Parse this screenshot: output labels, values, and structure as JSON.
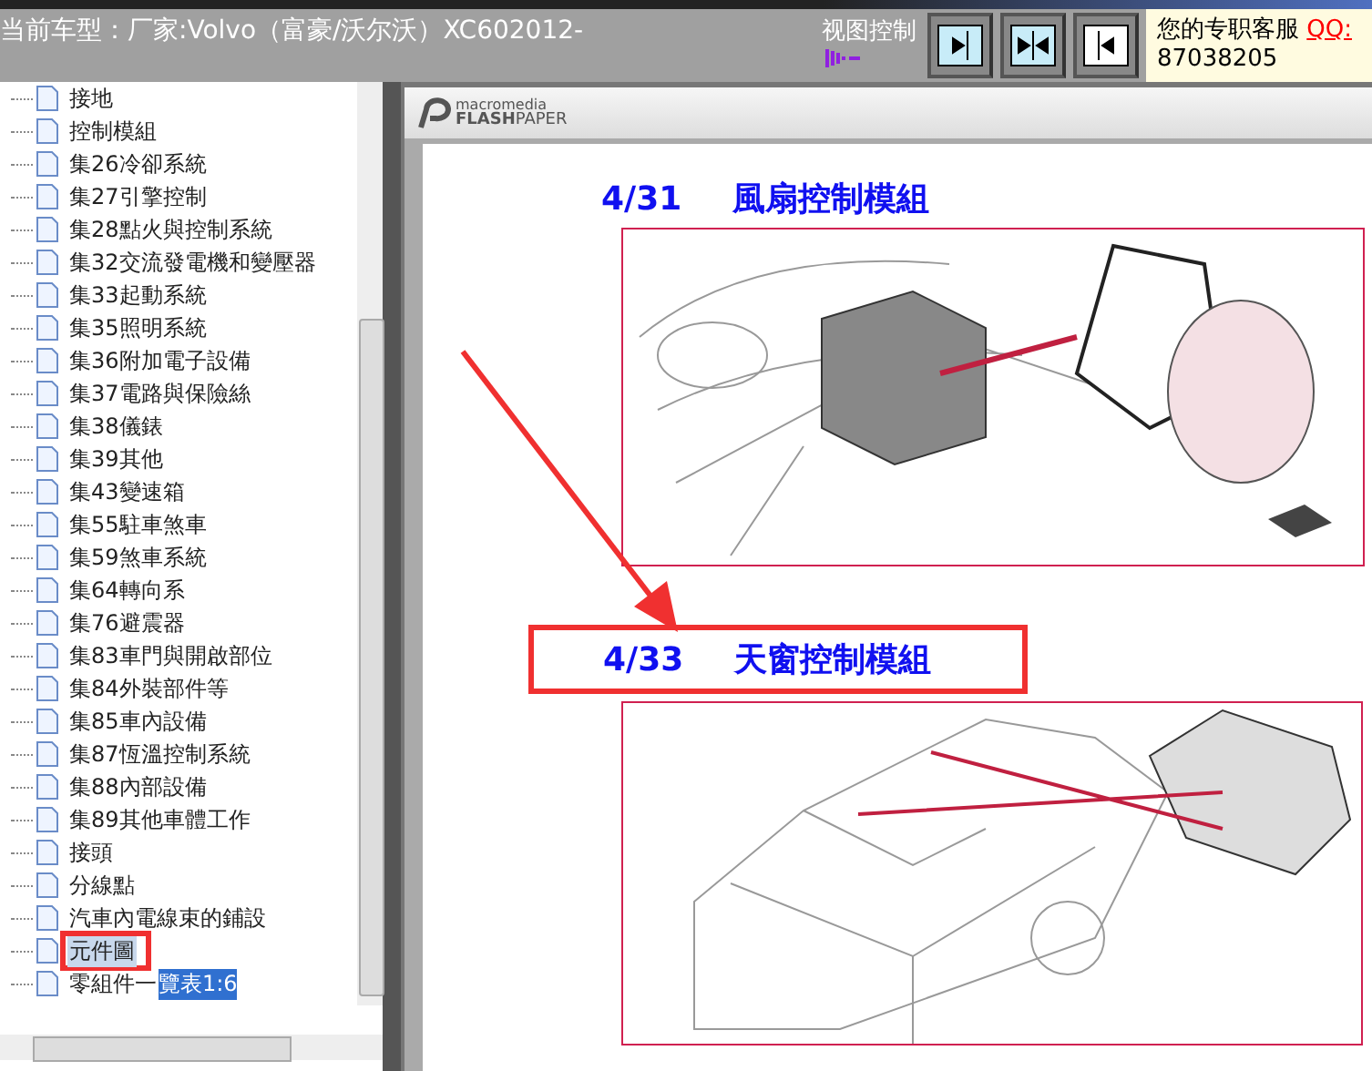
{
  "header": {
    "model": "当前车型：厂家:Volvo（富豪/沃尔沃）XC602012-",
    "view_control": "视图控制",
    "service_label": "您的专职客服",
    "qq_link": "QQ:",
    "qq_number": "87038205"
  },
  "tree": {
    "items": [
      {
        "label": "接地",
        "selected": false
      },
      {
        "label": "控制模組",
        "selected": false
      },
      {
        "label": "集26冷卻系統",
        "selected": false
      },
      {
        "label": "集27引擎控制",
        "selected": false
      },
      {
        "label": "集28點火與控制系統",
        "selected": false
      },
      {
        "label": "集32交流發電機和變壓器",
        "selected": false
      },
      {
        "label": "集33起動系統",
        "selected": false
      },
      {
        "label": "集35照明系統",
        "selected": false
      },
      {
        "label": "集36附加電子設備",
        "selected": false
      },
      {
        "label": "集37電路與保險絲",
        "selected": false
      },
      {
        "label": "集38儀錶",
        "selected": false
      },
      {
        "label": "集39其他",
        "selected": false
      },
      {
        "label": "集43變速箱",
        "selected": false
      },
      {
        "label": "集55駐車煞車",
        "selected": false
      },
      {
        "label": "集59煞車系統",
        "selected": false
      },
      {
        "label": "集64轉向系",
        "selected": false
      },
      {
        "label": "集76避震器",
        "selected": false
      },
      {
        "label": "集83車門與開啟部位",
        "selected": false
      },
      {
        "label": "集84外裝部件等",
        "selected": false
      },
      {
        "label": "集85車內設備",
        "selected": false
      },
      {
        "label": "集87恆溫控制系統",
        "selected": false
      },
      {
        "label": "集88內部設備",
        "selected": false
      },
      {
        "label": "集89其他車體工作",
        "selected": false
      },
      {
        "label": "接頭",
        "selected": false
      },
      {
        "label": "分線點",
        "selected": false
      },
      {
        "label": "汽車內電線束的鋪設",
        "selected": false
      },
      {
        "label": "元件圖",
        "selected": true,
        "annotated": true
      },
      {
        "label": "零組件一",
        "highlighted_text": "覽表1:6",
        "selected": false
      }
    ]
  },
  "viewer": {
    "brand_top": "macromedia",
    "brand_bold": "FLASH",
    "brand_light": "PAPER",
    "sections": [
      {
        "page": "4/31",
        "title": "風扇控制模組",
        "annotated": false,
        "kind": "fan"
      },
      {
        "page": "4/33",
        "title": "天窗控制模組",
        "annotated": true,
        "kind": "car"
      }
    ]
  }
}
